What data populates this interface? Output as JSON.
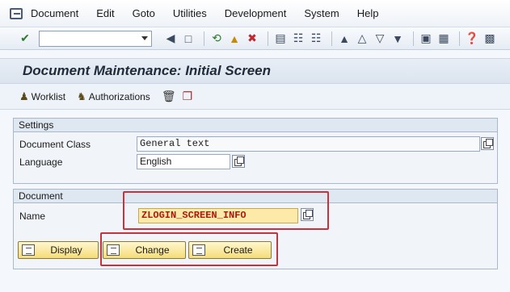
{
  "menu": {
    "items": [
      {
        "label": "Document"
      },
      {
        "label": "Edit"
      },
      {
        "label": "Goto"
      },
      {
        "label": "Utilities"
      },
      {
        "label": "Development"
      },
      {
        "label": "System"
      },
      {
        "label": "Help"
      }
    ]
  },
  "toolbar": {
    "command_field": "",
    "icons": [
      "enter-icon",
      "back-nav-icon",
      "save-icon",
      "back-icon",
      "exit-icon",
      "cancel-icon",
      "print-icon",
      "find-icon",
      "find-next-icon",
      "first-page-icon",
      "prev-page-icon",
      "next-page-icon",
      "last-page-icon",
      "new-session-icon",
      "shortcut-icon",
      "help-icon",
      "layout-icon"
    ]
  },
  "title": "Document Maintenance: Initial Screen",
  "app_toolbar": {
    "worklist_label": "Worklist",
    "authorizations_label": "Authorizations"
  },
  "settings": {
    "title": "Settings",
    "doc_class_label": "Document Class",
    "doc_class_value": "General text",
    "language_label": "Language",
    "language_value": "English"
  },
  "document": {
    "title": "Document",
    "name_label": "Name",
    "name_value": "ZLOGIN_SCREEN_INFO"
  },
  "buttons": {
    "display": "Display",
    "change": "Change",
    "create": "Create"
  },
  "colors": {
    "highlight_box": "#c8323a",
    "name_field_bg": "#fde9a8",
    "name_text": "#a61b0e",
    "button_bg": "#f5dc79"
  }
}
